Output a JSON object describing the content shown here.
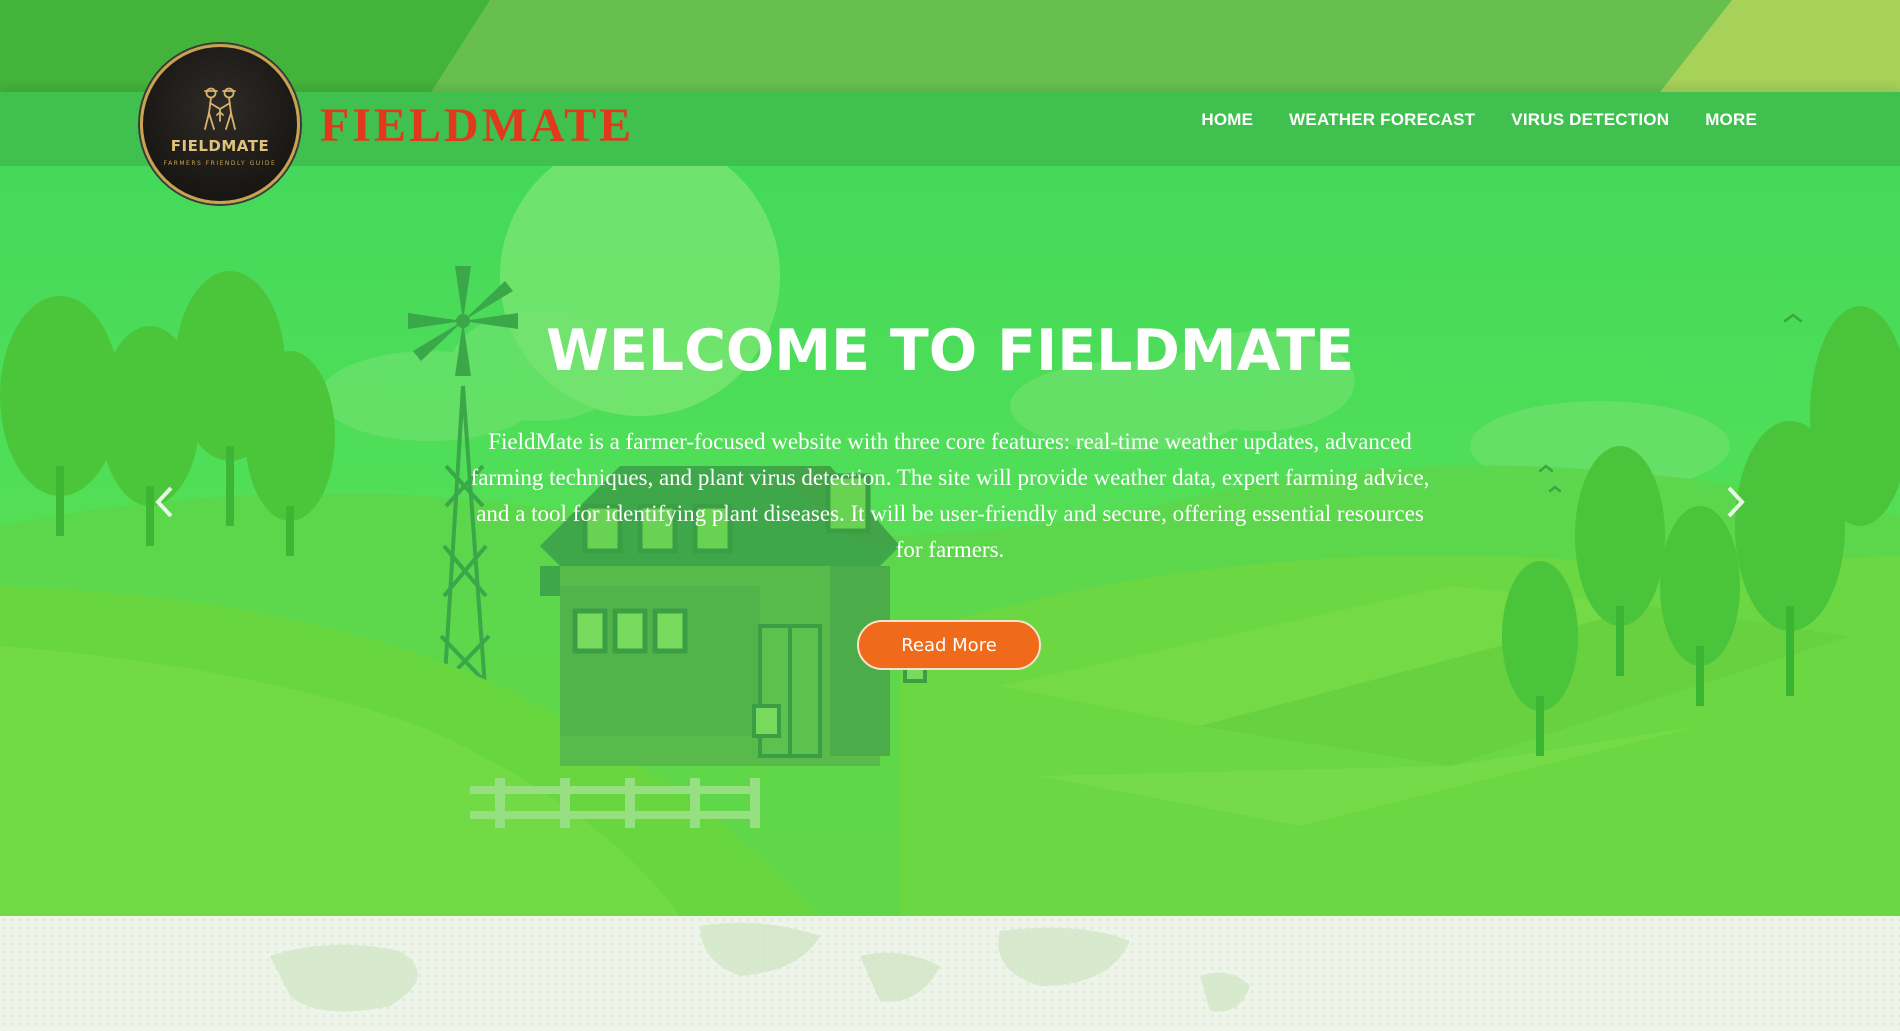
{
  "header": {
    "logo": {
      "badge_name": "FIELDMATE",
      "badge_tagline": "FARMERS FRIENDLY GUIDE",
      "icon": "farmers-icon"
    },
    "brand": "FIELDMATE",
    "nav": [
      {
        "label": "HOME"
      },
      {
        "label": "WEATHER FORECAST"
      },
      {
        "label": "VIRUS DETECTION"
      },
      {
        "label": "MORE"
      }
    ]
  },
  "hero": {
    "title": "WELCOME TO FIELDMATE",
    "description": "FieldMate is a farmer-focused website with three core features: real-time weather updates, advanced farming techniques, and plant virus detection. The site will provide weather data, expert farming advice, and a tool for identifying plant diseases. It will be user-friendly and secure, offering essential resources for farmers.",
    "button_label": "Read More",
    "prev_icon": "chevron-left-icon",
    "next_icon": "chevron-right-icon"
  },
  "colors": {
    "brand_red": "#e2391c",
    "header_green": "#3fc04f",
    "hero_green": "#47db5d",
    "button_orange": "#f06a1c",
    "logo_gold": "#c9a34f"
  }
}
